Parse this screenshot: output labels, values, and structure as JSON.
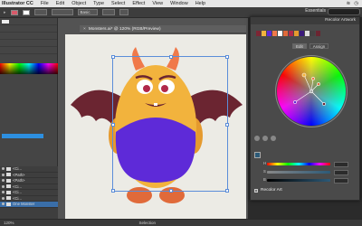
{
  "menubar": {
    "app_name": "Illustrator CC",
    "items": [
      "File",
      "Edit",
      "Object",
      "Type",
      "Select",
      "Effect",
      "View",
      "Window",
      "Help"
    ]
  },
  "control_bar": {
    "stroke_style": "Basic",
    "essentials": "Essentials"
  },
  "document": {
    "tab_title": "Monsters.ai* @ 120% (RGB/Preview)"
  },
  "left_panel": {
    "layers": [
      {
        "label": "<Ci..."
      },
      {
        "label": "<Path>"
      },
      {
        "label": "<Path>"
      },
      {
        "label": "<Ci..."
      },
      {
        "label": "<Ci..."
      },
      {
        "label": "<Ci..."
      },
      {
        "label": "One Monster"
      }
    ]
  },
  "recolor_panel": {
    "title": "Recolor Artwork",
    "tabs": [
      "Edit",
      "Assign"
    ],
    "active_tab": "Edit",
    "sliders": [
      "H",
      "S",
      "B"
    ],
    "recolor_art_label": "Recolor Art"
  },
  "statusbar": {
    "zoom": "120%",
    "selection": "Selection"
  },
  "colors": {
    "monster_body": "#f2b33d",
    "monster_belly": "#5e2ad8",
    "wing": "#6b2531",
    "horn": "#f0794a",
    "selection": "#5b8dd9"
  }
}
